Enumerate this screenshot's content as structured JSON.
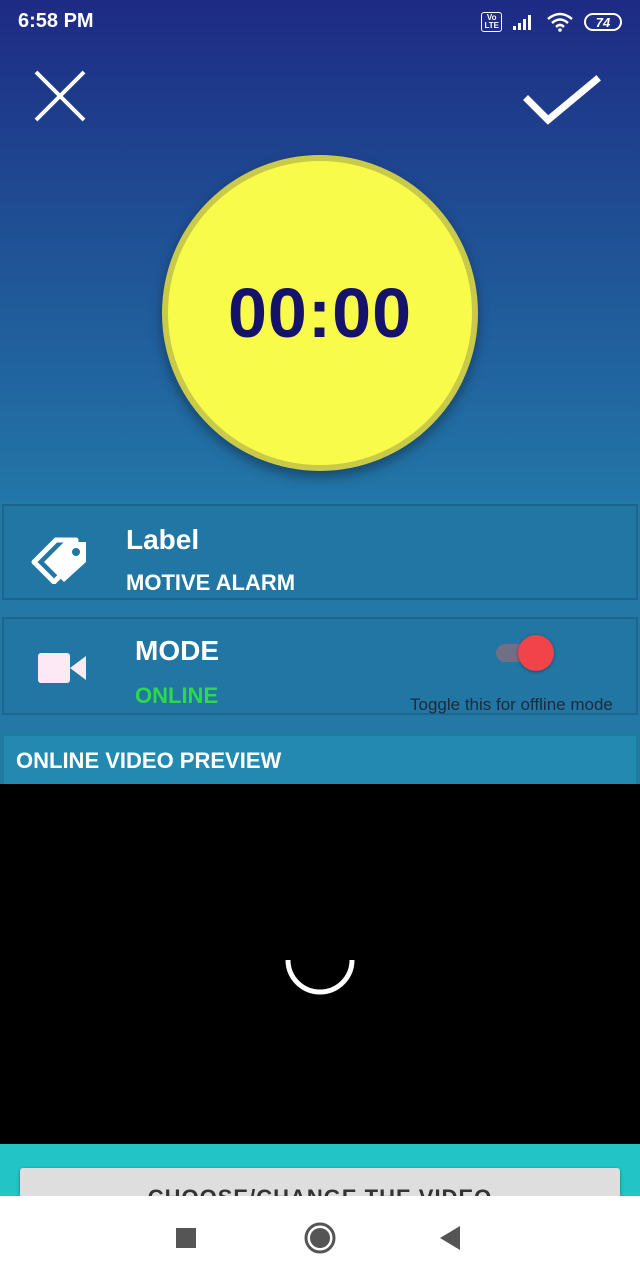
{
  "status_bar": {
    "time": "6:58 PM",
    "volte": "Vo LTE",
    "battery": "74",
    "icons": [
      "volte-icon",
      "signal-icon",
      "wifi-icon",
      "battery-icon"
    ]
  },
  "toolbar": {
    "close_icon": "close-icon",
    "confirm_icon": "check-icon"
  },
  "timer": {
    "display": "00:00",
    "circle_color": "#f8fb49",
    "text_color": "#15126b"
  },
  "label_card": {
    "icon": "tag-icon",
    "title": "Label",
    "value": "MOTIVE ALARM"
  },
  "mode_card": {
    "icon": "video-camera-icon",
    "title": "MODE",
    "value": "ONLINE",
    "value_color": "#2bd94a",
    "toggle_on": true,
    "toggle_hint": "Toggle this for offline mode"
  },
  "preview": {
    "title": "ONLINE VIDEO PREVIEW",
    "loading": true
  },
  "choose_button": {
    "label": "CHOOSE/CHANGE THE VIDEO"
  },
  "nav_bar": {
    "icons": [
      "recents-square-icon",
      "home-circle-icon",
      "back-triangle-icon"
    ]
  },
  "colors": {
    "header_gradient_top": "#1e2a84",
    "header_gradient_bottom": "#2276a8",
    "card_bg": "#2176a3",
    "toggle_thumb": "#f1434a",
    "bottom_panel": "#22c4c6"
  }
}
